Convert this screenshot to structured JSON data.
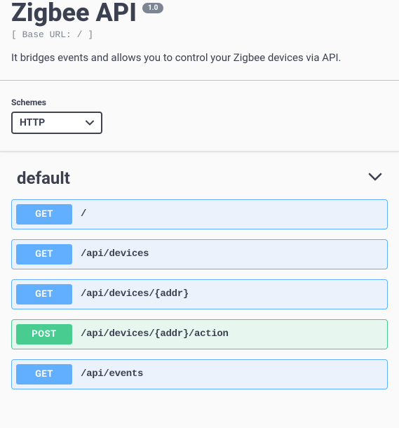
{
  "header": {
    "title": "Zigbee API",
    "version": "1.0",
    "base_url_text": "[ Base URL: / ]",
    "description": "It bridges events and allows you to control your Zigbee devices via API."
  },
  "schemes": {
    "label": "Schemes",
    "selected": "HTTP"
  },
  "section": {
    "title": "default"
  },
  "endpoints": [
    {
      "method": "GET",
      "path": "/"
    },
    {
      "method": "GET",
      "path": "/api/devices"
    },
    {
      "method": "GET",
      "path": "/api/devices/{addr}"
    },
    {
      "method": "POST",
      "path": "/api/devices/{addr}/action"
    },
    {
      "method": "GET",
      "path": "/api/events"
    }
  ],
  "colors": {
    "get": "#61affe",
    "post": "#49cc90"
  }
}
